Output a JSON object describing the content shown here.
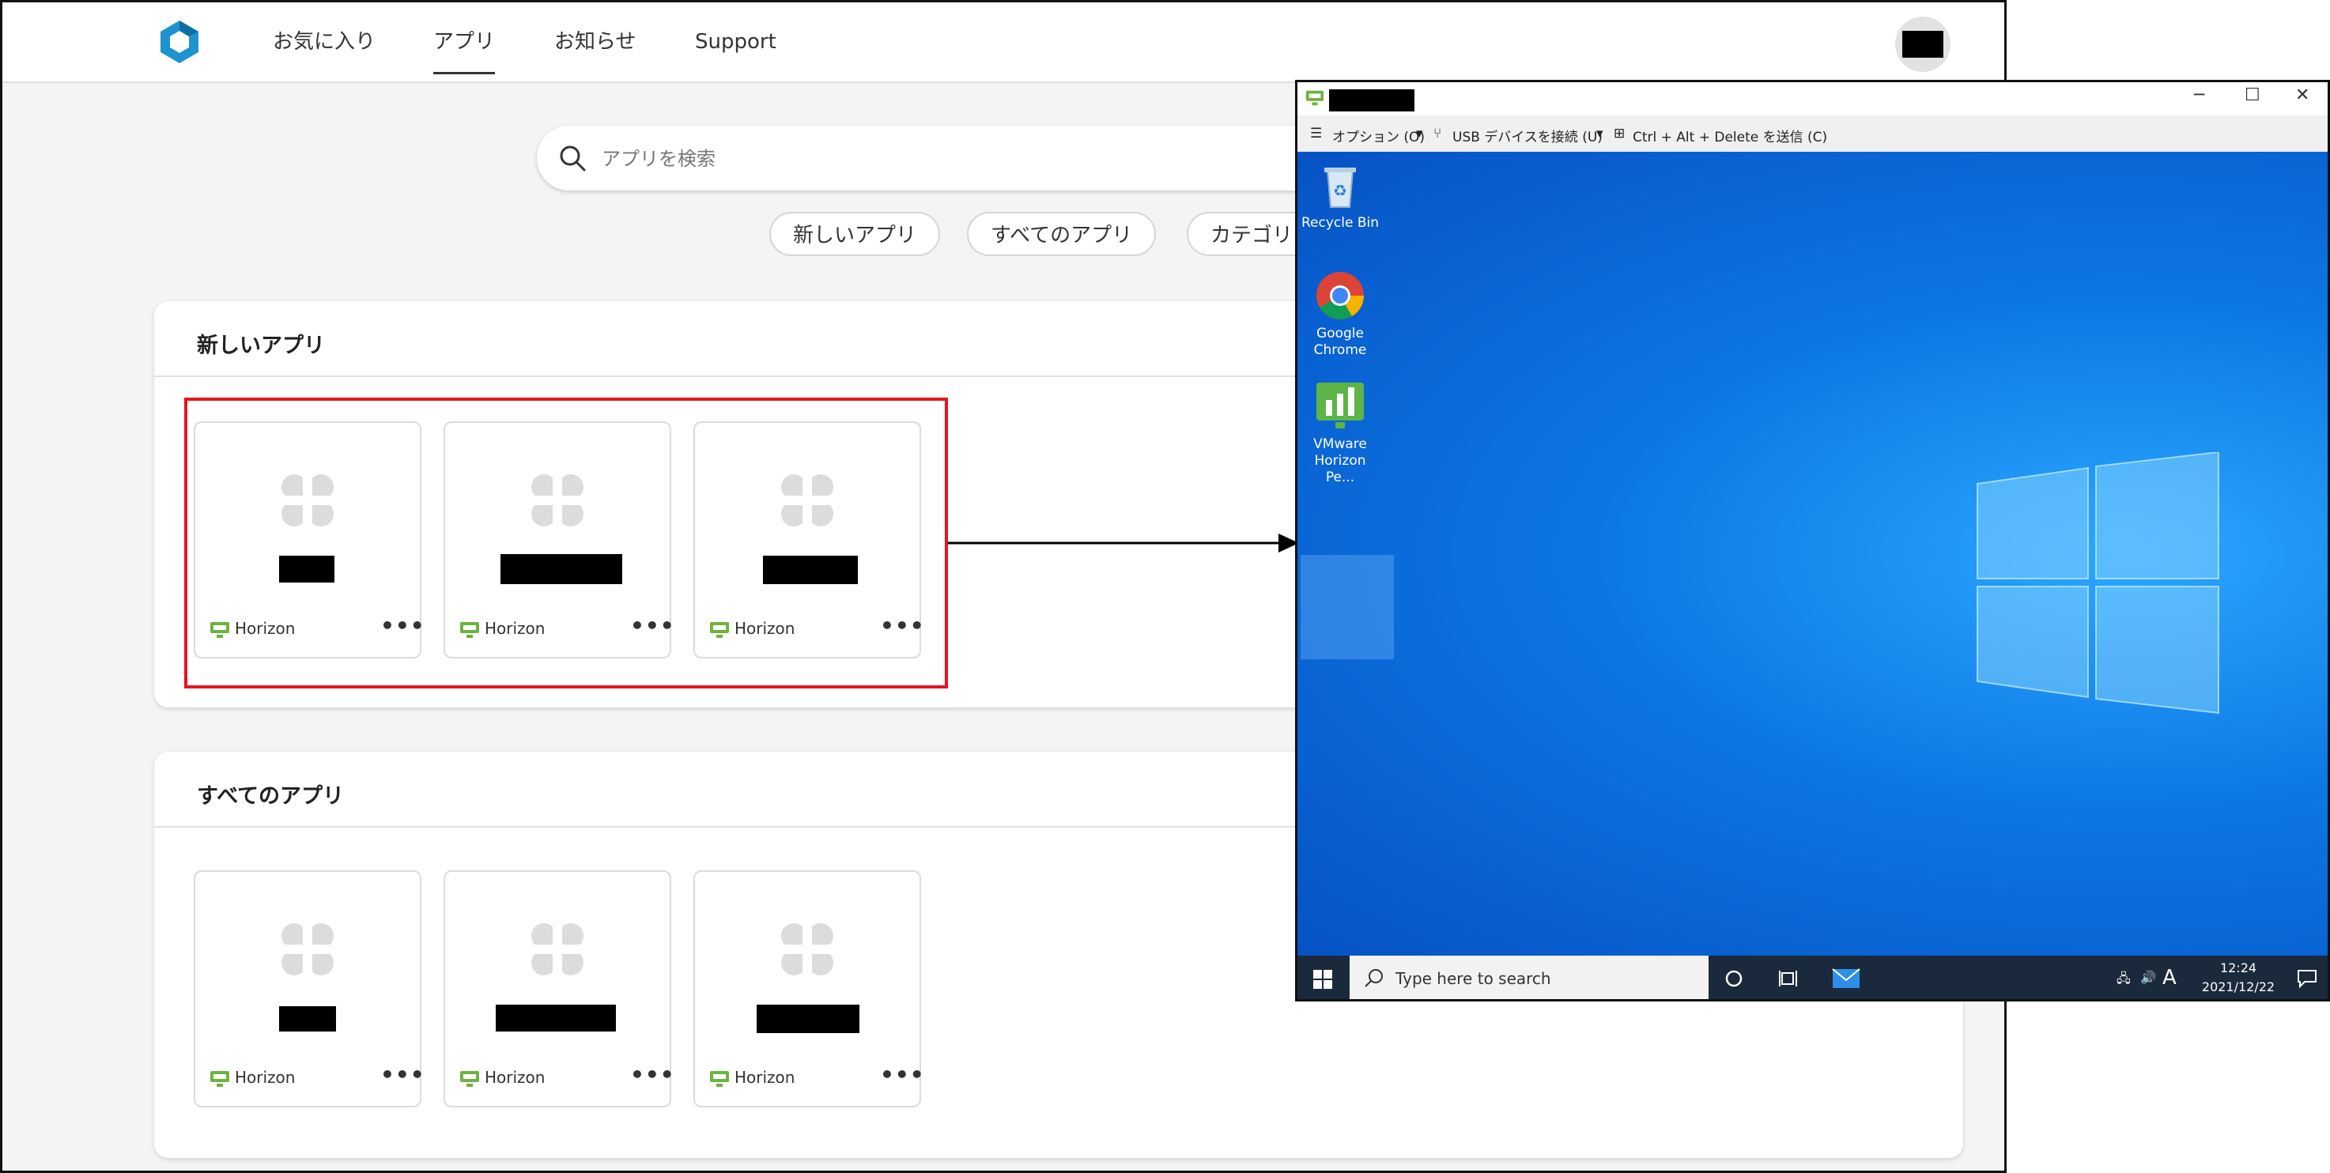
{
  "portal": {
    "nav": {
      "favorites": "お気に入り",
      "apps": "アプリ",
      "notifications": "お知らせ",
      "support": "Support"
    },
    "search": {
      "placeholder": "アプリを検索"
    },
    "chips": [
      "新しいアプリ",
      "すべてのアプリ",
      "カテゴリ"
    ],
    "sections": [
      {
        "title": "新しいアプリ",
        "cards": [
          {
            "brand": "Horizon",
            "more": "•••"
          },
          {
            "brand": "Horizon",
            "more": "•••"
          },
          {
            "brand": "Horizon",
            "more": "•••"
          }
        ]
      },
      {
        "title": "すべてのアプリ",
        "cards": [
          {
            "brand": "Horizon",
            "more": "•••"
          },
          {
            "brand": "Horizon",
            "more": "•••"
          },
          {
            "brand": "Horizon",
            "more": "•••"
          }
        ]
      }
    ],
    "colors": {
      "highlight": "#e8141d",
      "horizon_green": "#6db33f"
    }
  },
  "remote": {
    "toolbar": {
      "options": "オプション (O)",
      "usb": "USB デバイスを接続 (U)",
      "cad": "Ctrl + Alt + Delete を送信 (C)"
    },
    "desktop_icons": [
      "Recycle Bin",
      "Google Chrome",
      "VMware Horizon Pe..."
    ],
    "taskbar": {
      "search_placeholder": "Type here to search",
      "ime": "A",
      "time": "12:24",
      "date": "2021/12/22"
    },
    "colors": {
      "desktop_blue": "#0c77e4",
      "taskbar": "#1a2a3c"
    }
  }
}
